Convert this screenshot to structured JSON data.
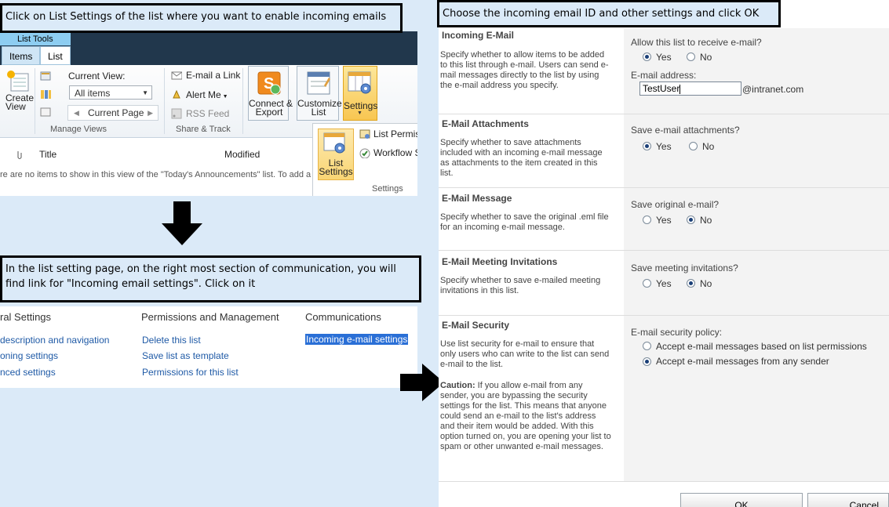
{
  "callouts": {
    "step1": "Click on List Settings of the list where you want to enable incoming emails",
    "step2": "In the list setting page, on the right most section of communication, you will find link for \"Incoming email settings\". Click on it",
    "step3": "Choose the incoming email ID and other settings and click OK"
  },
  "ribbon": {
    "context_tab": "List Tools",
    "tabs": [
      "Items",
      "List"
    ],
    "create_view": "Create\nView",
    "current_view_label": "Current View:",
    "current_view_value": "All items",
    "current_page": "Current Page",
    "manage_views": "Manage Views",
    "email_link": "E-mail a Link",
    "alert_me": "Alert Me",
    "rss_feed": "RSS Feed",
    "share_track": "Share & Track",
    "connect_export": "Connect &\nExport",
    "customize_list": "Customize\nList",
    "settings": "Settings",
    "list_settings": "List\nSettings",
    "list_permissions": "List Permiss",
    "workflow": "Workflow S",
    "settings_group": "Settings",
    "col_title": "Title",
    "col_modified": "Modified",
    "empty_msg": "re are no items to show in this view of the \"Today's Announcements\" list. To add a"
  },
  "list_settings_page": {
    "headings": [
      "ral Settings",
      "Permissions and Management",
      "Communications"
    ],
    "general_links": [
      "description and navigation",
      "oning settings",
      "nced settings"
    ],
    "permission_links": [
      "Delete this list",
      "Save list as template",
      "Permissions for this list"
    ],
    "communication_link": "Incoming e-mail settings"
  },
  "incoming_email_form": {
    "sections": [
      {
        "title": "Incoming E-Mail",
        "desc": "Specify whether to allow items to be added to this list through e-mail. Users can send e-mail messages directly to the list by using the e-mail address you specify.",
        "question": "Allow this list to receive e-mail?",
        "selected": "Yes"
      },
      {
        "title": "E-Mail Attachments",
        "desc": "Specify whether to save attachments included with an incoming e-mail message as attachments to the item created in this list.",
        "question": "Save e-mail attachments?",
        "selected": "Yes"
      },
      {
        "title": "E-Mail Message",
        "desc": "Specify whether to save the original .eml file for an incoming e-mail message.",
        "question": "Save original e-mail?",
        "selected": "No"
      },
      {
        "title": "E-Mail Meeting Invitations",
        "desc": "Specify whether to save e-mailed meeting invitations in this list.",
        "question": "Save meeting invitations?",
        "selected": "No"
      },
      {
        "title": "E-Mail Security",
        "desc": "Use list security for e-mail to ensure that only users who can write to the list can send e-mail to the list.",
        "question": "E-mail security policy:",
        "selected": "Accept e-mail messages from any sender"
      }
    ],
    "yes_label": "Yes",
    "no_label": "No",
    "email_address_label": "E-mail address:",
    "email_address_value": "TestUser",
    "email_domain": "@intranet.com",
    "caution_label": "Caution:",
    "caution_text": " If you allow e-mail from any sender, you are bypassing the security settings for the list. This means that anyone could send an e-mail to the list's address and their item would be added. With this option turned on, you are opening your list to spam or other unwanted e-mail messages.",
    "security_options": [
      "Accept e-mail messages based on list permissions",
      "Accept e-mail messages from any sender"
    ],
    "ok_label": "OK",
    "cancel_label": "Cancel"
  },
  "colors": {
    "background": "#dbeaf8",
    "ribbon_dark": "#21374c",
    "link": "#1f5aa6",
    "highlight": "#f8c651",
    "selected_link_bg": "#2a6fd6"
  }
}
